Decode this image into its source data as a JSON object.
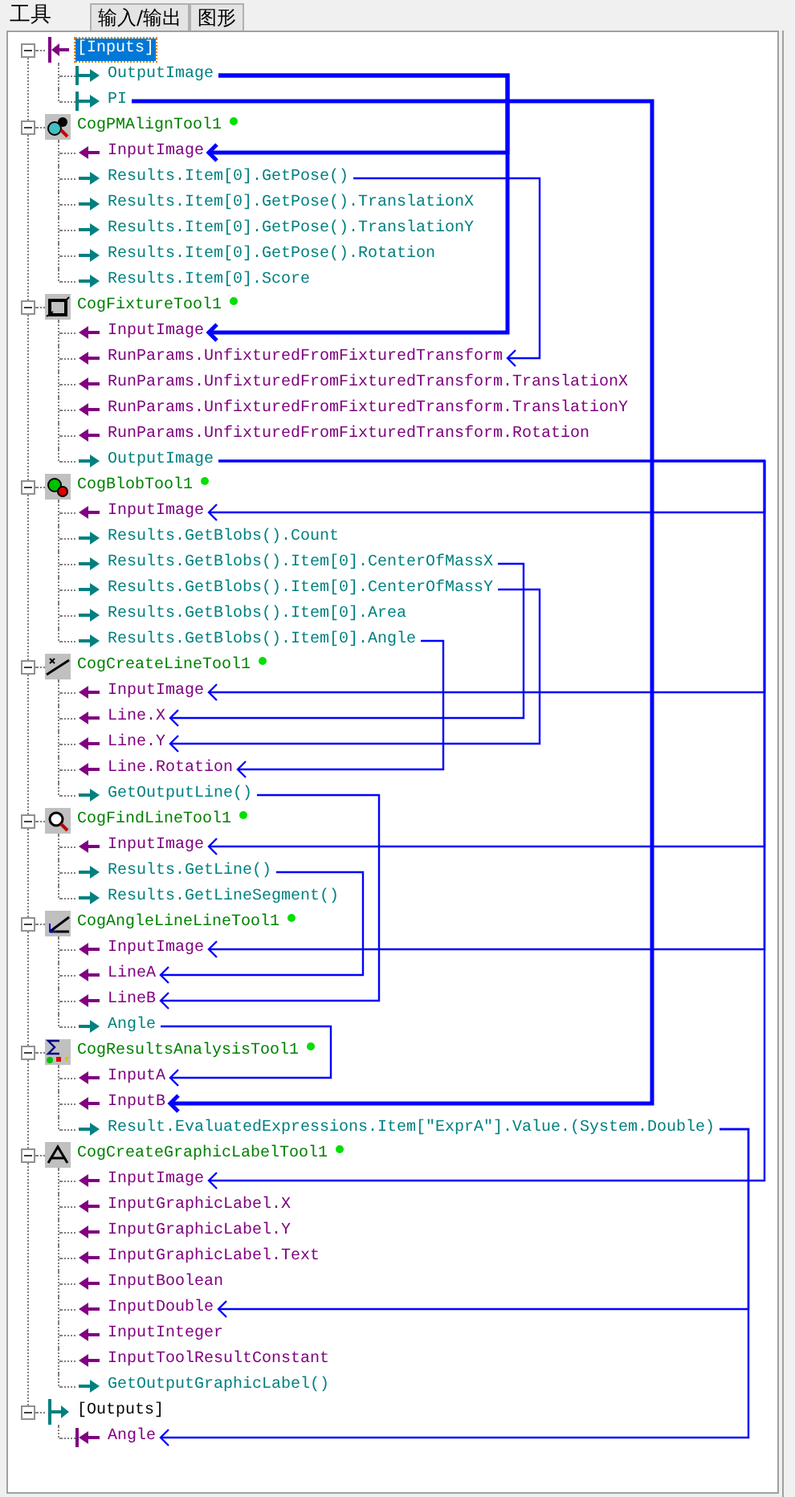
{
  "tabs": [
    {
      "label": "工具",
      "selected": true
    },
    {
      "label": "输入/输出",
      "selected": false
    },
    {
      "label": "图形",
      "selected": false
    }
  ],
  "nodes": [
    {
      "label": "[Inputs]",
      "kind": "inputs",
      "selected": true,
      "expanded": true,
      "children": [
        {
          "label": "OutputImage",
          "kind": "out",
          "selected": false
        },
        {
          "label": "PI",
          "kind": "out",
          "selected": false
        }
      ]
    },
    {
      "label": "CogPMAlignTool1",
      "kind": "tool",
      "ok": true,
      "selected": false,
      "expanded": true,
      "children": [
        {
          "label": "InputImage",
          "kind": "in",
          "selected": false
        },
        {
          "label": "Results.Item[0].GetPose()",
          "kind": "out",
          "selected": false
        },
        {
          "label": "Results.Item[0].GetPose().TranslationX",
          "kind": "out",
          "selected": false
        },
        {
          "label": "Results.Item[0].GetPose().TranslationY",
          "kind": "out",
          "selected": false
        },
        {
          "label": "Results.Item[0].GetPose().Rotation",
          "kind": "out",
          "selected": false
        },
        {
          "label": "Results.Item[0].Score",
          "kind": "out",
          "selected": false
        }
      ]
    },
    {
      "label": "CogFixtureTool1",
      "kind": "tool",
      "ok": true,
      "selected": false,
      "expanded": true,
      "children": [
        {
          "label": "InputImage",
          "kind": "in",
          "selected": false
        },
        {
          "label": "RunParams.UnfixturedFromFixturedTransform",
          "kind": "in",
          "selected": false
        },
        {
          "label": "RunParams.UnfixturedFromFixturedTransform.TranslationX",
          "kind": "in",
          "selected": false
        },
        {
          "label": "RunParams.UnfixturedFromFixturedTransform.TranslationY",
          "kind": "in",
          "selected": false
        },
        {
          "label": "RunParams.UnfixturedFromFixturedTransform.Rotation",
          "kind": "in",
          "selected": false
        },
        {
          "label": "OutputImage",
          "kind": "out",
          "selected": false
        }
      ]
    },
    {
      "label": "CogBlobTool1",
      "kind": "tool",
      "ok": true,
      "selected": false,
      "expanded": true,
      "children": [
        {
          "label": "InputImage",
          "kind": "in",
          "selected": false
        },
        {
          "label": "Results.GetBlobs().Count",
          "kind": "out",
          "selected": false
        },
        {
          "label": "Results.GetBlobs().Item[0].CenterOfMassX",
          "kind": "out",
          "selected": false
        },
        {
          "label": "Results.GetBlobs().Item[0].CenterOfMassY",
          "kind": "out",
          "selected": false
        },
        {
          "label": "Results.GetBlobs().Item[0].Area",
          "kind": "out",
          "selected": false
        },
        {
          "label": "Results.GetBlobs().Item[0].Angle",
          "kind": "out",
          "selected": false
        }
      ]
    },
    {
      "label": "CogCreateLineTool1",
      "kind": "tool",
      "ok": true,
      "selected": false,
      "expanded": true,
      "children": [
        {
          "label": "InputImage",
          "kind": "in",
          "selected": false
        },
        {
          "label": "Line.X",
          "kind": "in",
          "selected": false
        },
        {
          "label": "Line.Y",
          "kind": "in",
          "selected": false
        },
        {
          "label": "Line.Rotation",
          "kind": "in",
          "selected": false
        },
        {
          "label": "GetOutputLine()",
          "kind": "out",
          "selected": false
        }
      ]
    },
    {
      "label": "CogFindLineTool1",
      "kind": "tool",
      "ok": true,
      "selected": false,
      "expanded": true,
      "children": [
        {
          "label": "InputImage",
          "kind": "in",
          "selected": false
        },
        {
          "label": "Results.GetLine()",
          "kind": "out",
          "selected": false
        },
        {
          "label": "Results.GetLineSegment()",
          "kind": "out",
          "selected": false
        }
      ]
    },
    {
      "label": "CogAngleLineLineTool1",
      "kind": "tool",
      "ok": true,
      "selected": false,
      "expanded": true,
      "children": [
        {
          "label": "InputImage",
          "kind": "in",
          "selected": false
        },
        {
          "label": "LineA",
          "kind": "in",
          "selected": false
        },
        {
          "label": "LineB",
          "kind": "in",
          "selected": false
        },
        {
          "label": "Angle",
          "kind": "out",
          "selected": false
        }
      ]
    },
    {
      "label": "CogResultsAnalysisTool1",
      "kind": "tool",
      "ok": true,
      "selected": false,
      "expanded": true,
      "children": [
        {
          "label": "InputA",
          "kind": "in",
          "selected": false
        },
        {
          "label": "InputB",
          "kind": "in",
          "selected": false
        },
        {
          "label": "Result.EvaluatedExpressions.Item[\"ExprA\"].Value.(System.Double)",
          "kind": "out",
          "selected": false
        }
      ]
    },
    {
      "label": "CogCreateGraphicLabelTool1",
      "kind": "tool",
      "ok": true,
      "selected": false,
      "expanded": true,
      "children": [
        {
          "label": "InputImage",
          "kind": "in",
          "selected": false
        },
        {
          "label": "InputGraphicLabel.X",
          "kind": "in",
          "selected": false
        },
        {
          "label": "InputGraphicLabel.Y",
          "kind": "in",
          "selected": false
        },
        {
          "label": "InputGraphicLabel.Text",
          "kind": "in",
          "selected": false
        },
        {
          "label": "InputBoolean",
          "kind": "in",
          "selected": false
        },
        {
          "label": "InputDouble",
          "kind": "in",
          "selected": false
        },
        {
          "label": "InputInteger",
          "kind": "in",
          "selected": false
        },
        {
          "label": "InputToolResultConstant",
          "kind": "in",
          "selected": false
        },
        {
          "label": "GetOutputGraphicLabel()",
          "kind": "out",
          "selected": false
        }
      ]
    },
    {
      "label": "[Outputs]",
      "kind": "outputs",
      "selected": false,
      "expanded": true,
      "children": [
        {
          "label": "Angle",
          "kind": "in",
          "selected": false
        }
      ]
    }
  ]
}
